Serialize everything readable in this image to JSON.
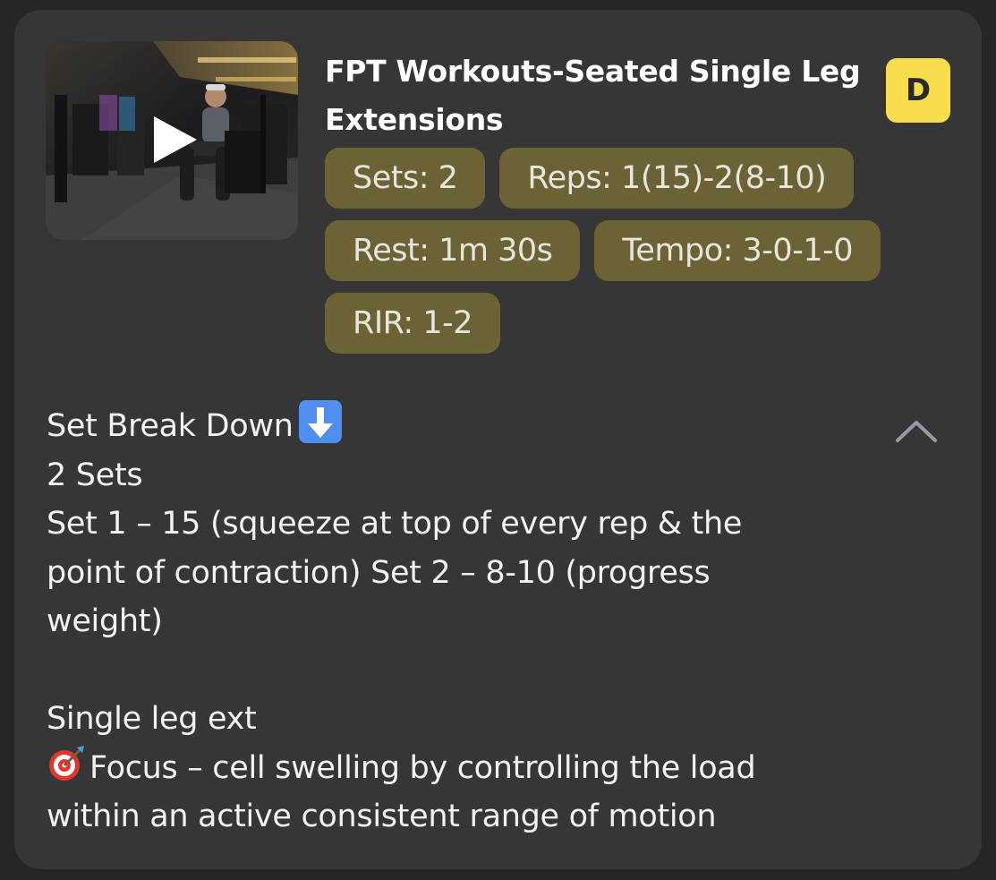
{
  "exercise": {
    "title": "FPT Workouts-Seated Single Leg Extensions",
    "difficulty_badge": "D",
    "thumbnail_icon": "play-icon",
    "chips": {
      "sets": "Sets: 2",
      "reps": "Reps: 1(15)-2(8-10)",
      "rest": "Rest: 1m 30s",
      "tempo": "Tempo: 3-0-1-0",
      "rir": "RIR: 1-2"
    },
    "description": {
      "heading": "Set Break Down",
      "heading_icon": "down-arrow-emoji-icon",
      "line_sets": "2 Sets",
      "line_set1": "Set 1 – 15 (squeeze at top of every rep & the",
      "line_set1b": "point of contraction) Set 2 – 8-10 (progress",
      "line_set1c": "weight)",
      "line_blank": "",
      "line_single": "Single leg ext",
      "focus_icon": "target-emoji-icon",
      "line_focus": "Focus – cell swelling by controlling the load",
      "line_focus2": "within an active consistent range of motion"
    },
    "collapse_icon": "chevron-up-icon"
  },
  "colors": {
    "card_bg": "#363636",
    "chip_bg": "#6b6336",
    "badge_bg": "#f7dc4e",
    "page_bg": "#262626"
  }
}
